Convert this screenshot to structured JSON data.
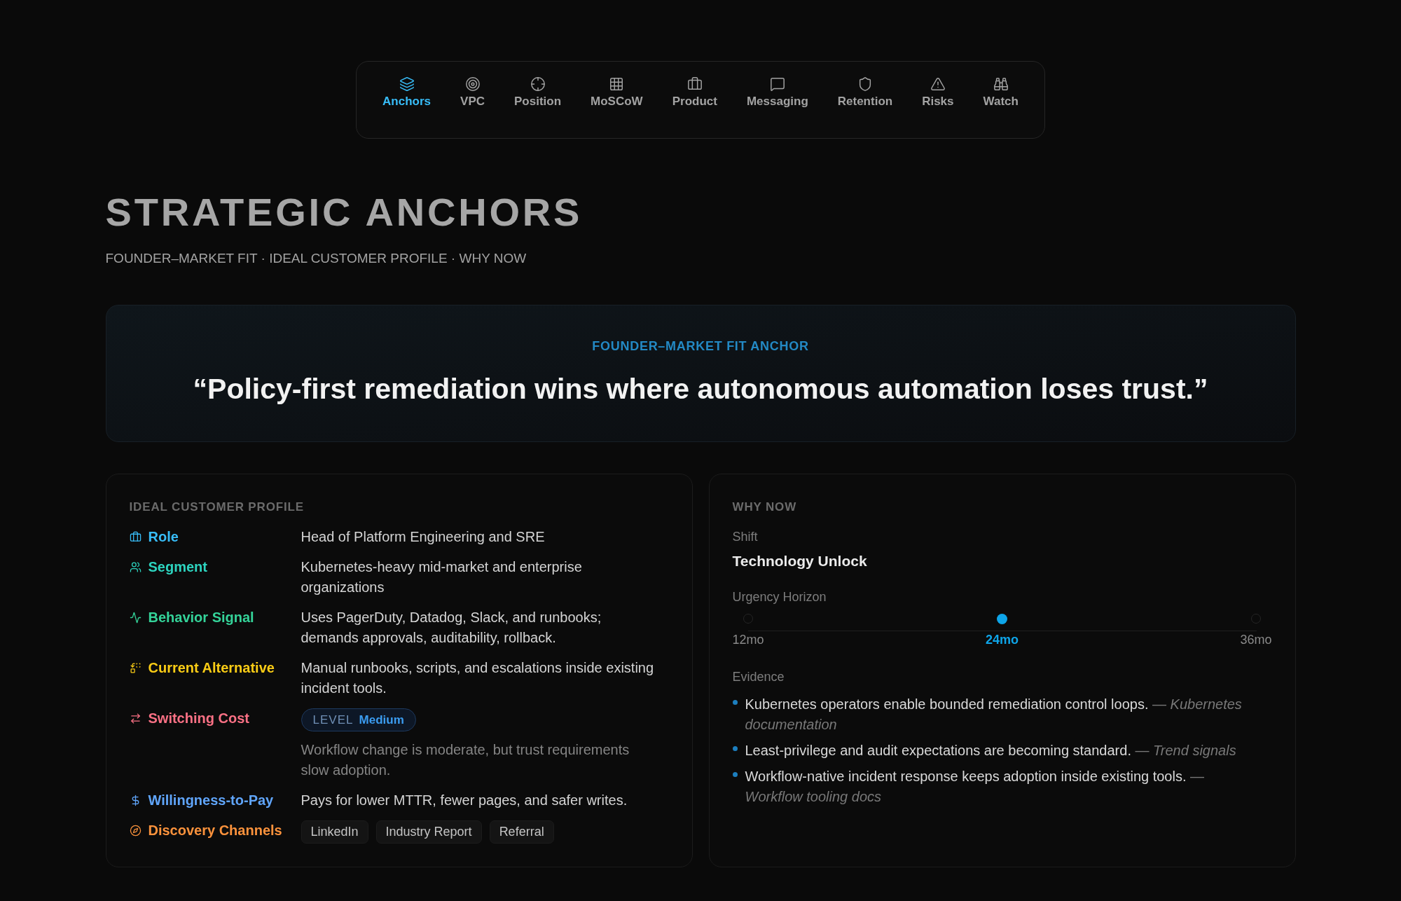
{
  "nav": {
    "tabs": [
      {
        "label": "Anchors",
        "selected": true
      },
      {
        "label": "VPC",
        "selected": false
      },
      {
        "label": "Position",
        "selected": false
      },
      {
        "label": "MoSCoW",
        "selected": false
      },
      {
        "label": "Product",
        "selected": false
      },
      {
        "label": "Messaging",
        "selected": false
      },
      {
        "label": "Retention",
        "selected": false
      },
      {
        "label": "Risks",
        "selected": false
      },
      {
        "label": "Watch",
        "selected": false
      }
    ]
  },
  "header": {
    "title": "STRATEGIC ANCHORS",
    "subtitle": "FOUNDER–MARKET FIT · IDEAL CUSTOMER PROFILE · WHY NOW"
  },
  "anchor": {
    "label": "FOUNDER–MARKET FIT ANCHOR",
    "quote": "“Policy-first remediation wins where autonomous automation loses trust.”"
  },
  "icp": {
    "title": "IDEAL CUSTOMER PROFILE",
    "rows": [
      {
        "kind": "text",
        "label": "Role",
        "color": "#38bdf8",
        "value": "Head of Platform Engineering and SRE"
      },
      {
        "kind": "text",
        "label": "Segment",
        "color": "#2dd4bf",
        "value": "Kubernetes-heavy mid-market and enterprise organizations"
      },
      {
        "kind": "text",
        "label": "Behavior Signal",
        "color": "#34d399",
        "value": "Uses PagerDuty, Datadog, Slack, and runbooks; demands approvals, auditability, rollback."
      },
      {
        "kind": "text",
        "label": "Current Alternative",
        "color": "#facc15",
        "value": "Manual runbooks, scripts, and escalations inside existing incident tools."
      },
      {
        "kind": "level",
        "label": "Switching Cost",
        "color": "#fb7185",
        "badge_label": "LEVEL",
        "badge_value": "Medium",
        "note": "Workflow change is moderate, but trust requirements slow adoption."
      },
      {
        "kind": "text",
        "label": "Willingness-to-Pay",
        "color": "#60a5fa",
        "value": "Pays for lower MTTR, fewer pages, and safer writes."
      },
      {
        "kind": "chips",
        "label": "Discovery Channels",
        "color": "#fb923c",
        "chips": [
          "LinkedIn",
          "Industry Report",
          "Referral"
        ]
      }
    ]
  },
  "why_now": {
    "title": "WHY NOW",
    "shift_label": "Shift",
    "shift": "Technology Unlock",
    "horizon_label": "Urgency Horizon",
    "horizon": [
      {
        "label": "12mo",
        "selected": false
      },
      {
        "label": "24mo",
        "selected": true
      },
      {
        "label": "36mo",
        "selected": false
      }
    ],
    "evidence_label": "Evidence",
    "evidence": [
      {
        "text": "Kubernetes operators enable bounded remediation control loops.",
        "source": "— *Kubernetes documentation*"
      },
      {
        "text": "Least-privilege and audit expectations are becoming standard.",
        "source": "— *Trend signals*"
      },
      {
        "text": "Workflow-native incident response keeps adoption inside existing tools.",
        "source": "— *Workflow tooling docs*"
      }
    ]
  }
}
